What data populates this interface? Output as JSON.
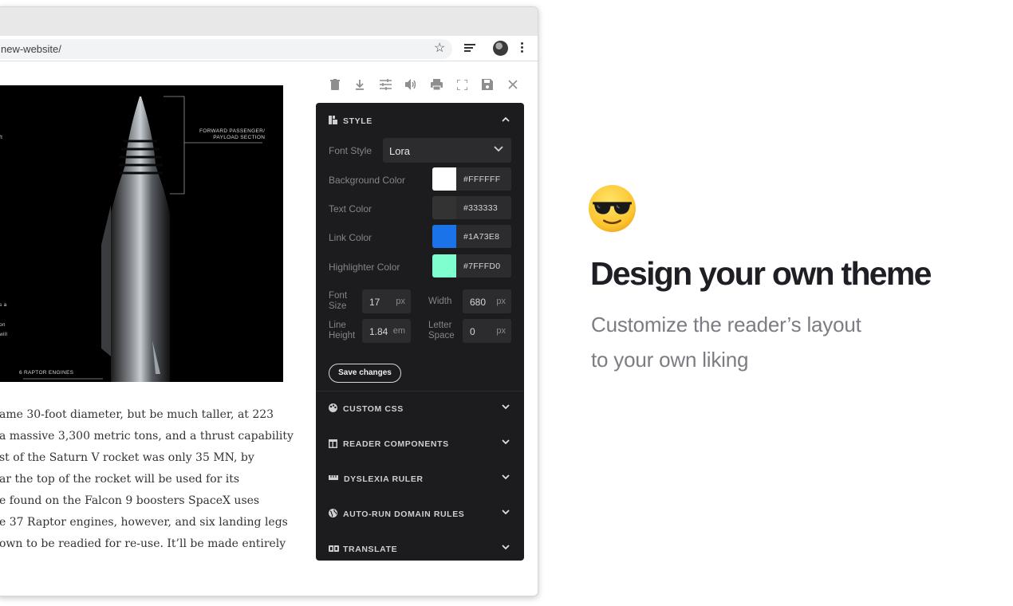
{
  "browser": {
    "url": "new-website/"
  },
  "article": {
    "image_labels": {
      "forward": "FORWARD PASSENGER/\nPAYLOAD SECTION",
      "raptor": "6 RAPTOR ENGINES",
      "left_a": "ft",
      "left_b": "s a",
      "left_c": "on",
      "left_d": "will"
    },
    "lines": [
      "ame 30-foot diameter, but be much taller, at 223",
      "a massive 3,300 metric tons, and a thrust capability",
      "st of the Saturn V rocket was only 35 MN, by",
      "ar the top of the rocket will be used for its",
      "e found on the Falcon 9 boosters SpaceX uses",
      "e 37 Raptor engines, however, and six landing legs",
      "own to be readied for re-use. It’ll be made entirely"
    ]
  },
  "panel": {
    "style_title": "STYLE",
    "font_style_label": "Font Style",
    "font_style_value": "Lora",
    "colors": [
      {
        "label": "Background Color",
        "hex": "#FFFFFF",
        "swatch": "#FFFFFF"
      },
      {
        "label": "Text Color",
        "hex": "#333333",
        "swatch": "#333333"
      },
      {
        "label": "Link Color",
        "hex": "#1A73E8",
        "swatch": "#1A73E8"
      },
      {
        "label": "Highlighter Color",
        "hex": "#7FFFD0",
        "swatch": "#7FFFD0"
      }
    ],
    "font_size": {
      "label_1": "Font",
      "label_2": "Size",
      "value": "17",
      "unit": "px"
    },
    "width": {
      "label": "Width",
      "value": "680",
      "unit": "px"
    },
    "line_height": {
      "label_1": "Line",
      "label_2": "Height",
      "value": "1.84",
      "unit": "em"
    },
    "letter_space": {
      "label_1": "Letter",
      "label_2": "Space",
      "value": "0",
      "unit": "px"
    },
    "save_label": "Save changes",
    "sections": [
      "CUSTOM CSS",
      "READER COMPONENTS",
      "DYSLEXIA RULER",
      "AUTO-RUN DOMAIN RULES",
      "TRANSLATE"
    ]
  },
  "promo": {
    "headline": "Design your own theme",
    "sub_1": "Customize the reader’s layout",
    "sub_2": "to your own liking"
  }
}
